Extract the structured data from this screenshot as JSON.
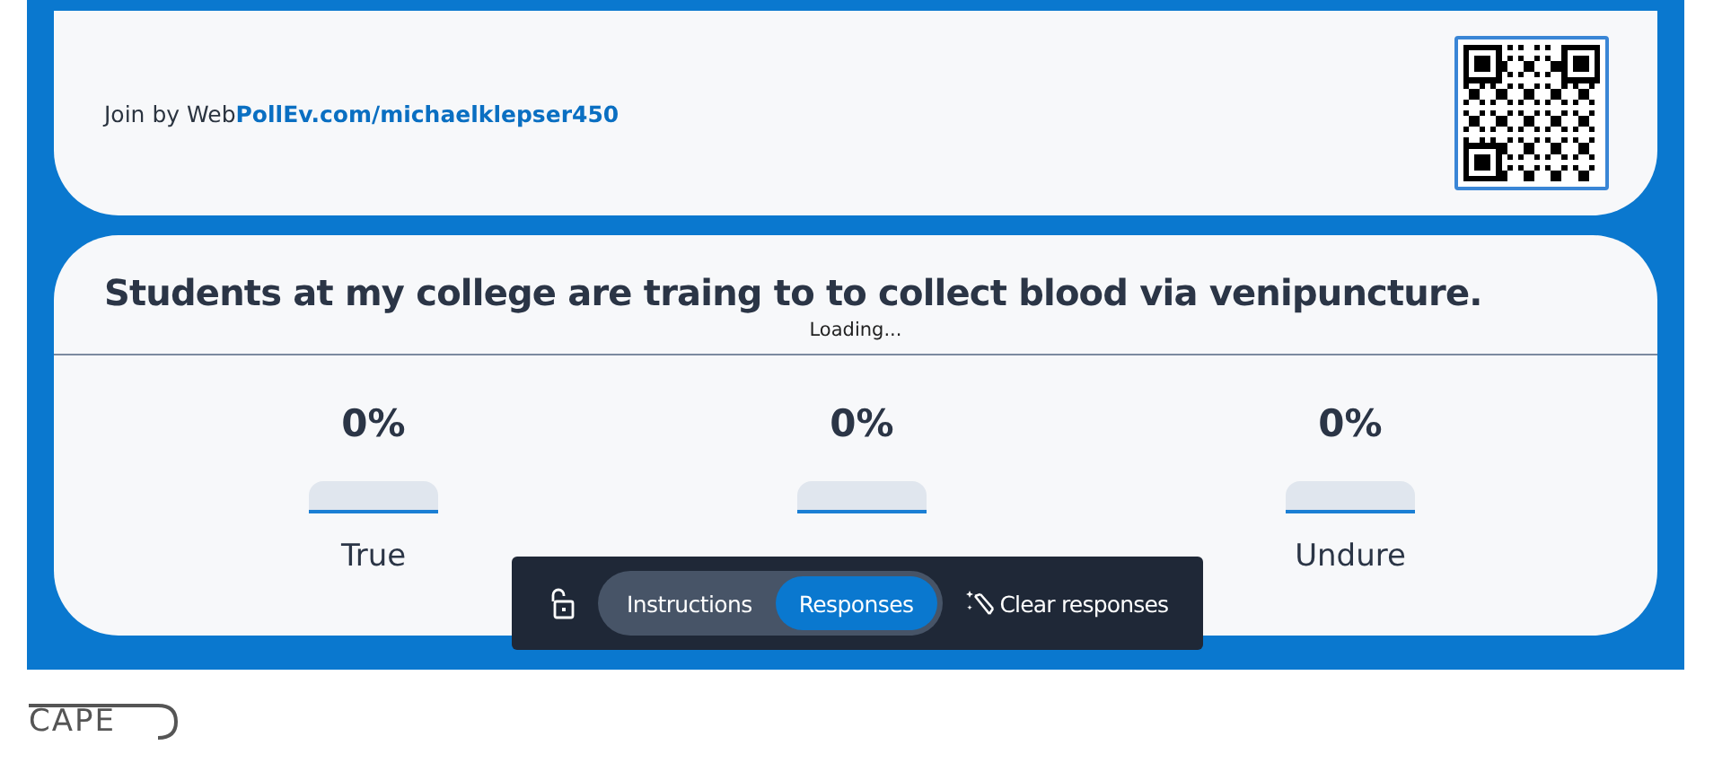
{
  "join": {
    "prefix": "Join by Web",
    "link": "PollEv.com/michaelklepser450"
  },
  "question": {
    "title": "Students at my college are traing to to collect blood via venipuncture.",
    "status": "Loading..."
  },
  "choices": [
    {
      "percent": "0%",
      "level": 0,
      "label": "True"
    },
    {
      "percent": "0%",
      "level": 0
    },
    {
      "percent": "0%",
      "level": 0,
      "label": "Undure"
    }
  ],
  "toolbar": {
    "tabs": [
      {
        "label": "Instructions",
        "selected": false
      },
      {
        "label": "Responses",
        "selected": true
      }
    ],
    "clear_button": "Clear responses"
  },
  "logo": {
    "text": "CAPE"
  }
}
